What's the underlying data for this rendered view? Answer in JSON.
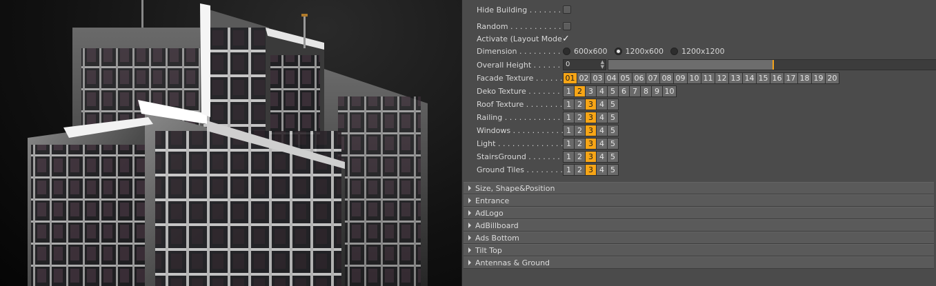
{
  "viewport": {
    "description_icon": "building-render"
  },
  "panel": {
    "hide_building": {
      "label": "Hide Building . . . . . . . .",
      "checked": false
    },
    "random": {
      "label": "Random . . . . . . . . . . . . .",
      "checked": false
    },
    "activate_layout": {
      "label": "Activate (Layout Mode)",
      "check_glyph": "✓",
      "checked": true
    },
    "dimension": {
      "label": "Dimension . . . . . . . . . .",
      "options": [
        "600x600",
        "1200x600",
        "1200x1200"
      ],
      "selected": "1200x600"
    },
    "overall_height": {
      "label": "Overall Height . . . . . . .",
      "value": "0",
      "spinner": "▲▼",
      "slider_fraction": 0.5
    },
    "facade_texture": {
      "label": "Facade Texture . . . . . . .",
      "options": [
        "01",
        "02",
        "03",
        "04",
        "05",
        "06",
        "07",
        "08",
        "09",
        "10",
        "11",
        "12",
        "13",
        "14",
        "15",
        "16",
        "17",
        "18",
        "19",
        "20"
      ],
      "selected": "01"
    },
    "deko_texture": {
      "label": "Deko Texture . . . . . . . .",
      "options": [
        "1",
        "2",
        "3",
        "4",
        "5",
        "6",
        "7",
        "8",
        "9",
        "10"
      ],
      "selected": "2"
    },
    "roof_texture": {
      "label": "Roof Texture . . . . . . . .",
      "options": [
        "1",
        "2",
        "3",
        "4",
        "5"
      ],
      "selected": "3"
    },
    "railing": {
      "label": "Railing . . . . . . . . . . . .",
      "options": [
        "1",
        "2",
        "3",
        "4",
        "5"
      ],
      "selected": "3"
    },
    "windows": {
      "label": "Windows . . . . . . . . . . .",
      "options": [
        "1",
        "2",
        "3",
        "4",
        "5"
      ],
      "selected": "3"
    },
    "light": {
      "label": "Light . . . . . . . . . . . . . .",
      "options": [
        "1",
        "2",
        "3",
        "4",
        "5"
      ],
      "selected": "3"
    },
    "stairs_ground": {
      "label": "StairsGround . . . . . . . .",
      "options": [
        "1",
        "2",
        "3",
        "4",
        "5"
      ],
      "selected": "3"
    },
    "ground_tiles": {
      "label": "Ground Tiles . . . . . . . .",
      "options": [
        "1",
        "2",
        "3",
        "4",
        "5"
      ],
      "selected": "3"
    }
  },
  "sections": [
    {
      "title": "Size, Shape&Position"
    },
    {
      "title": "Entrance"
    },
    {
      "title": "AdLogo"
    },
    {
      "title": "AdBillboard"
    },
    {
      "title": "Ads Bottom"
    },
    {
      "title": "Tilt Top"
    },
    {
      "title": "Antennas & Ground"
    }
  ],
  "colors": {
    "accent": "#f7a516",
    "panel_bg": "#4b4b4b",
    "button_bg": "#6a6a6a"
  }
}
